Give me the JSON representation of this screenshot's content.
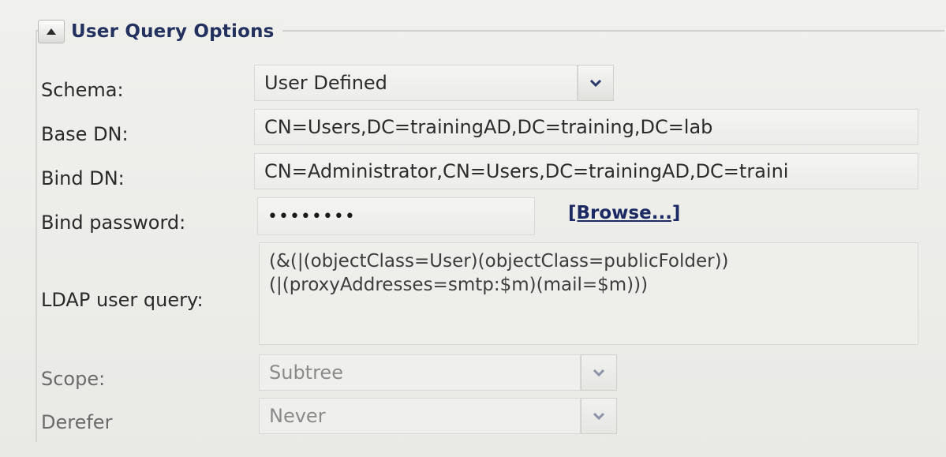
{
  "section": {
    "title": "User Query Options",
    "collapse_icon": "triangle-up-icon"
  },
  "schema": {
    "label": "Schema:",
    "value": "User Defined",
    "dropdown_icon": "chevron-down-icon"
  },
  "base_dn": {
    "label": "Base DN:",
    "value": "CN=Users,DC=trainingAD,DC=training,DC=lab"
  },
  "bind_dn": {
    "label": "Bind DN:",
    "value": "CN=Administrator,CN=Users,DC=trainingAD,DC=traini"
  },
  "bind_password": {
    "label": "Bind password:",
    "value": "••••••••",
    "browse_label": "[Browse...]"
  },
  "ldap_query": {
    "label": "LDAP user query:",
    "value": "(&(|(objectClass=User)(objectClass=publicFolder))\n(|(proxyAddresses=smtp:$m)(mail=$m)))"
  },
  "scope": {
    "label": "Scope:",
    "value": "Subtree",
    "dropdown_icon": "chevron-down-icon"
  },
  "derefer": {
    "label": "Derefer",
    "value": "Never",
    "dropdown_icon": "chevron-down-icon"
  },
  "colors": {
    "title": "#23315f",
    "link": "#1c2a63",
    "label": "#2a2a2a",
    "disabled_text": "#8a8a8a"
  }
}
